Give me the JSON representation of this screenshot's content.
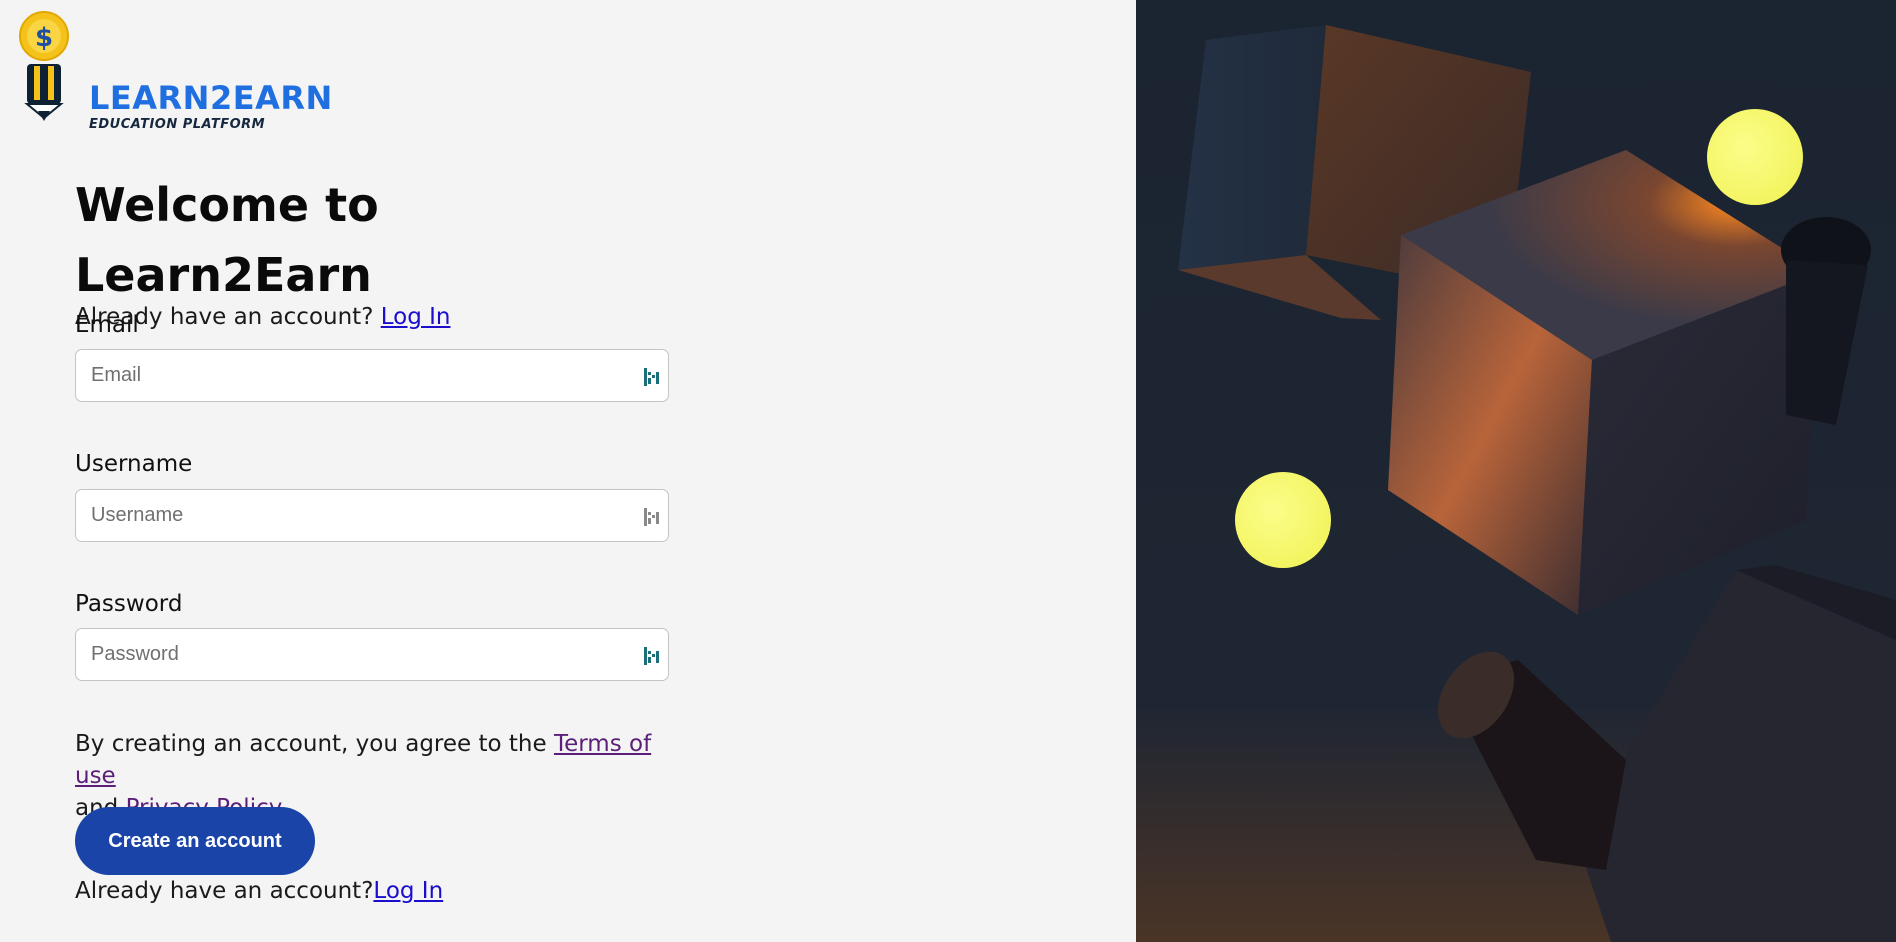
{
  "brand": {
    "name": "LEARN2EARN",
    "tagline": "EDUCATION PLATFORM",
    "coin_symbol": "$",
    "colors": {
      "primary": "#1f6fe0",
      "dark": "#16283f",
      "coin": "#f4c21a"
    }
  },
  "heading": "Welcome to Learn2Earn",
  "top_login": {
    "prompt": "Already have an account?",
    "link": "Log In"
  },
  "fields": {
    "email": {
      "label": "Email",
      "placeholder": "Email",
      "value": ""
    },
    "username": {
      "label": "Username",
      "placeholder": "Username",
      "value": ""
    },
    "password": {
      "label": "Password",
      "placeholder": "Password",
      "value": ""
    }
  },
  "field_icon": "password-manager-icon",
  "terms": {
    "prefix": "By creating an account, you agree to the",
    "terms_link": "Terms of use",
    "and": "and",
    "privacy_link": "Privacy Policy."
  },
  "cta": {
    "label": "Create an account",
    "color": "#1a44a8"
  },
  "bottom_login": {
    "prompt": "Already have an account?",
    "link": "Log In"
  },
  "hero": {
    "background": "#1b2431",
    "accent_orange": "#ff8a1f",
    "sphere_color": "#f8fb6a"
  }
}
